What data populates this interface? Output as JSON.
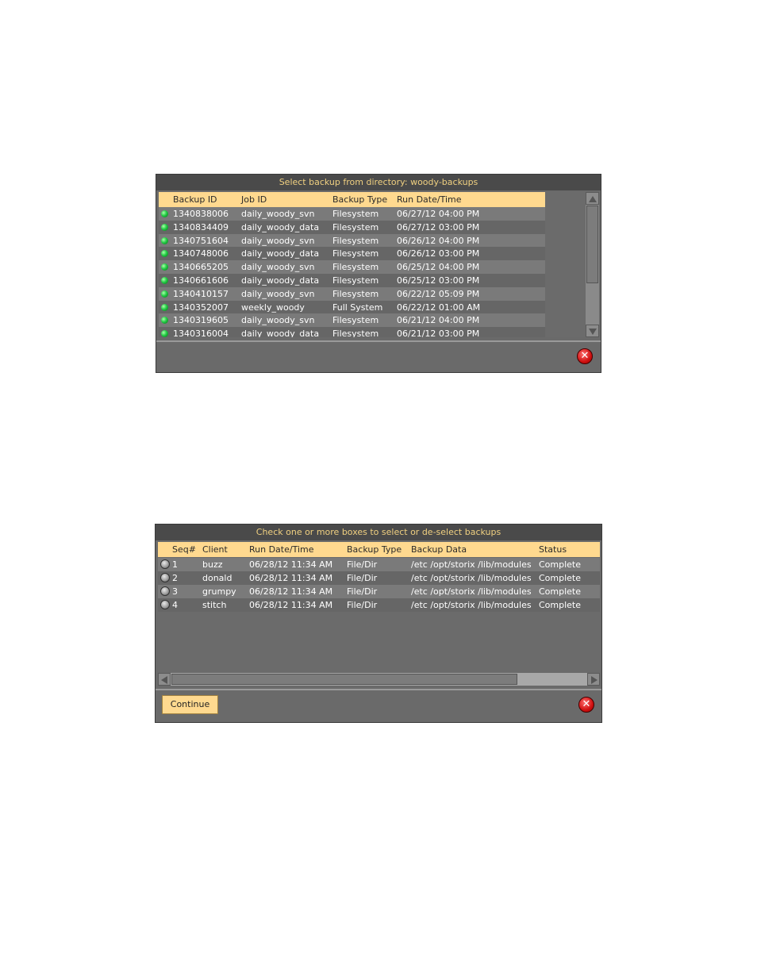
{
  "dialog1": {
    "title": "Select backup from directory: woody-backups",
    "columns": [
      "Backup ID",
      "Job ID",
      "Backup Type",
      "Run Date/Time"
    ],
    "rows": [
      [
        "1340838006",
        "daily_woody_svn",
        "Filesystem",
        "06/27/12 04:00 PM"
      ],
      [
        "1340834409",
        "daily_woody_data",
        "Filesystem",
        "06/27/12 03:00 PM"
      ],
      [
        "1340751604",
        "daily_woody_svn",
        "Filesystem",
        "06/26/12 04:00 PM"
      ],
      [
        "1340748006",
        "daily_woody_data",
        "Filesystem",
        "06/26/12 03:00 PM"
      ],
      [
        "1340665205",
        "daily_woody_svn",
        "Filesystem",
        "06/25/12 04:00 PM"
      ],
      [
        "1340661606",
        "daily_woody_data",
        "Filesystem",
        "06/25/12 03:00 PM"
      ],
      [
        "1340410157",
        "daily_woody_svn",
        "Filesystem",
        "06/22/12 05:09 PM"
      ],
      [
        "1340352007",
        "weekly_woody",
        "Full System",
        "06/22/12 01:00 AM"
      ],
      [
        "1340319605",
        "daily_woody_svn",
        "Filesystem",
        "06/21/12 04:00 PM"
      ],
      [
        "1340316004",
        "daily_woody_data",
        "Filesystem",
        "06/21/12 03:00 PM"
      ]
    ],
    "close_icon": "close-icon",
    "status_icon": "green-dot-icon"
  },
  "dialog2": {
    "title": "Check one or more boxes to select or de-select backups",
    "columns": [
      "Seq#",
      "Client",
      "Run Date/Time",
      "Backup Type",
      "Backup Data",
      "Status"
    ],
    "rows": [
      [
        "1",
        "buzz",
        "06/28/12 11:34 AM",
        "File/Dir",
        "/etc /opt/storix /lib/modules",
        "Complete"
      ],
      [
        "2",
        "donald",
        "06/28/12 11:34 AM",
        "File/Dir",
        "/etc /opt/storix /lib/modules",
        "Complete"
      ],
      [
        "3",
        "grumpy",
        "06/28/12 11:34 AM",
        "File/Dir",
        "/etc /opt/storix /lib/modules",
        "Complete"
      ],
      [
        "4",
        "stitch",
        "06/28/12 11:34 AM",
        "File/Dir",
        "/etc /opt/storix /lib/modules",
        "Complete"
      ]
    ],
    "continue_label": "Continue",
    "close_icon": "close-icon",
    "checkbox_icon": "radio-checkbox-icon"
  },
  "colors": {
    "title_text": "#f0d080",
    "header_bg": "#ffd98f",
    "panel_bg": "#6a6a6a"
  }
}
